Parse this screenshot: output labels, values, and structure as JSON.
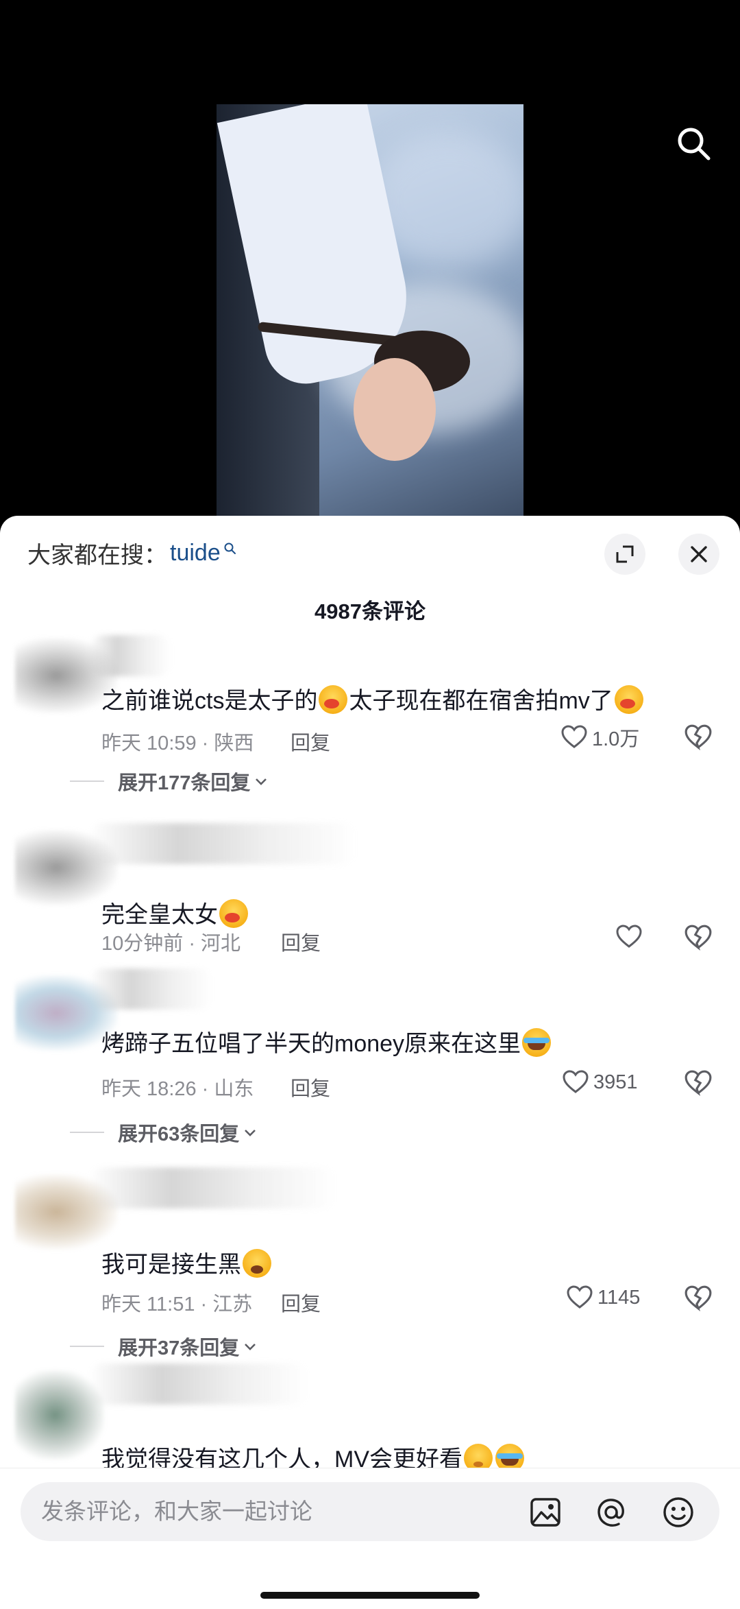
{
  "trending": {
    "prefix": "大家都在搜：",
    "keyword": "tuide"
  },
  "comments_count": "4987条评论",
  "comments": [
    {
      "text_a": "之前谁说cts是太子的",
      "text_b": "太子现在都在宿舍拍mv了",
      "emoji_a": "kiss-emoji",
      "emoji_b": "kiss-emoji",
      "time": "昨天 10:59 · 陕西",
      "reply": "回复",
      "likes": "1.0万",
      "expand": "展开177条回复"
    },
    {
      "text_a": "完全皇太女",
      "emoji_a": "kiss-emoji",
      "time": "10分钟前 · 河北",
      "reply": "回复",
      "likes": ""
    },
    {
      "text_a": "烤蹄子五位唱了半天的money原来在这里",
      "emoji_a": "cry-laugh-emoji",
      "time": "昨天 18:26 · 山东",
      "reply": "回复",
      "likes": "3951",
      "expand": "展开63条回复"
    },
    {
      "text_a": "我可是接生黑",
      "emoji_a": "sob-emoji",
      "time": "昨天 11:51 · 江苏",
      "reply": "回复",
      "likes": "1145",
      "expand": "展开37条回复"
    },
    {
      "text_a": "我觉得没有这几个人，MV会更好看",
      "emoji_a": "shy-emoji",
      "emoji_b": "cry-laugh-emoji"
    }
  ],
  "input": {
    "placeholder": "发条评论，和大家一起讨论"
  },
  "icons": {
    "search": "search-icon",
    "expand": "expand-icon",
    "close": "close-icon",
    "like": "heart-icon",
    "dislike": "broken-heart-icon",
    "image": "image-icon",
    "mention": "at-icon",
    "emoji": "smiley-icon"
  }
}
